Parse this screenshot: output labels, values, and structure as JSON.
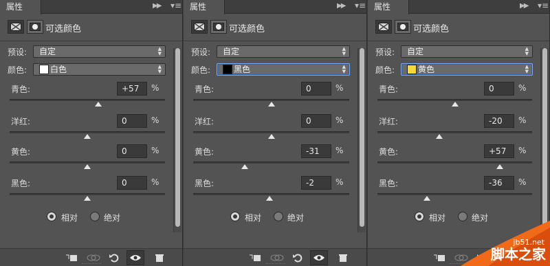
{
  "panels": [
    {
      "tab_label": "属性",
      "title": "可选颜色",
      "preset_label": "预设:",
      "preset_value": "自定",
      "color_label": "颜色:",
      "color_value": "白色",
      "swatch_color": "#ffffff",
      "sliders": [
        {
          "label": "青色:",
          "value": "+57",
          "position": 0.57
        },
        {
          "label": "洋红:",
          "value": "0",
          "position": 0.5
        },
        {
          "label": "黄色:",
          "value": "0",
          "position": 0.5
        },
        {
          "label": "黑色:",
          "value": "0",
          "position": 0.5
        }
      ],
      "pct": "%",
      "radio_relative": "相对",
      "radio_absolute": "绝对",
      "dropdown_focused": false
    },
    {
      "tab_label": "属性",
      "title": "可选颜色",
      "preset_label": "预设:",
      "preset_value": "自定",
      "color_label": "颜色:",
      "color_value": "黑色",
      "swatch_color": "#000000",
      "sliders": [
        {
          "label": "青色:",
          "value": "0",
          "position": 0.5
        },
        {
          "label": "洋红:",
          "value": "0",
          "position": 0.5
        },
        {
          "label": "黄色:",
          "value": "-31",
          "position": 0.33
        },
        {
          "label": "黑色:",
          "value": "-2",
          "position": 0.49
        }
      ],
      "pct": "%",
      "radio_relative": "相对",
      "radio_absolute": "绝对",
      "dropdown_focused": true
    },
    {
      "tab_label": "属性",
      "title": "可选颜色",
      "preset_label": "预设:",
      "preset_value": "自定",
      "color_label": "颜色:",
      "color_value": "黄色",
      "swatch_color": "#f5d93a",
      "sliders": [
        {
          "label": "青色:",
          "value": "0",
          "position": 0.5
        },
        {
          "label": "洋红:",
          "value": "-20",
          "position": 0.4
        },
        {
          "label": "黄色:",
          "value": "+57",
          "position": 0.79
        },
        {
          "label": "黑色:",
          "value": "-36",
          "position": 0.32
        }
      ],
      "pct": "%",
      "radio_relative": "相对",
      "radio_absolute": "绝对",
      "dropdown_focused": true
    }
  ],
  "watermark": {
    "url": "jb51.net",
    "text": "脚本之家"
  }
}
